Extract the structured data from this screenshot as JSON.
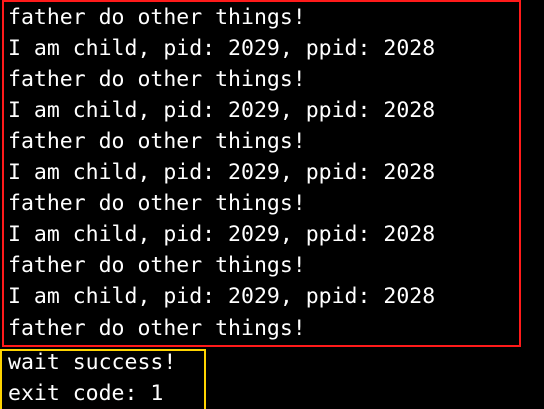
{
  "terminal": {
    "output_lines": [
      "father do other things!",
      "I am child, pid: 2029, ppid: 2028",
      "father do other things!",
      "I am child, pid: 2029, ppid: 2028",
      "father do other things!",
      "I am child, pid: 2029, ppid: 2028",
      "father do other things!",
      "I am child, pid: 2029, ppid: 2028",
      "father do other things!",
      "I am child, pid: 2029, ppid: 2028",
      "father do other things!",
      "wait success!",
      "exit code: 1"
    ]
  },
  "highlights": {
    "loop_output_box_color": "#ff1a1a",
    "wait_result_box_color": "#ffd400"
  }
}
